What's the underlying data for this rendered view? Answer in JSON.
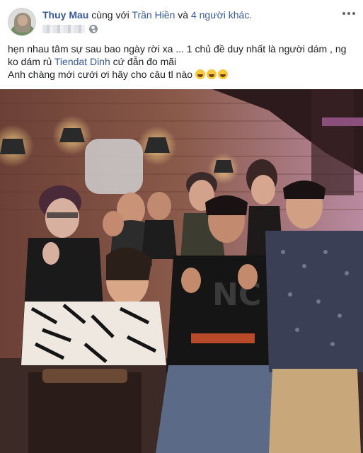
{
  "post": {
    "author": "Thuy Mau",
    "with_text": "cùng với",
    "tagged": "Trần Hiền",
    "and_text": "và",
    "others": "4 người khác.",
    "privacy_icon": "globe-icon",
    "more_icon": "more-dots-icon",
    "lines": {
      "line1": "hẹn nhau tâm sự sau bao ngày rời xa ... 1 chủ đề duy nhất là người dám , ng",
      "line2_before": "ko dám rủ",
      "line2_mention": "Tiendat Dinh",
      "line2_after": "cứ đẫn đo mãi",
      "line3": "Anh chàng mới cưới ơi hãy cho câu tl nào"
    },
    "reaction_emoji": "rolling-on-floor-laughing",
    "photo_description_icon": "group-photo"
  }
}
